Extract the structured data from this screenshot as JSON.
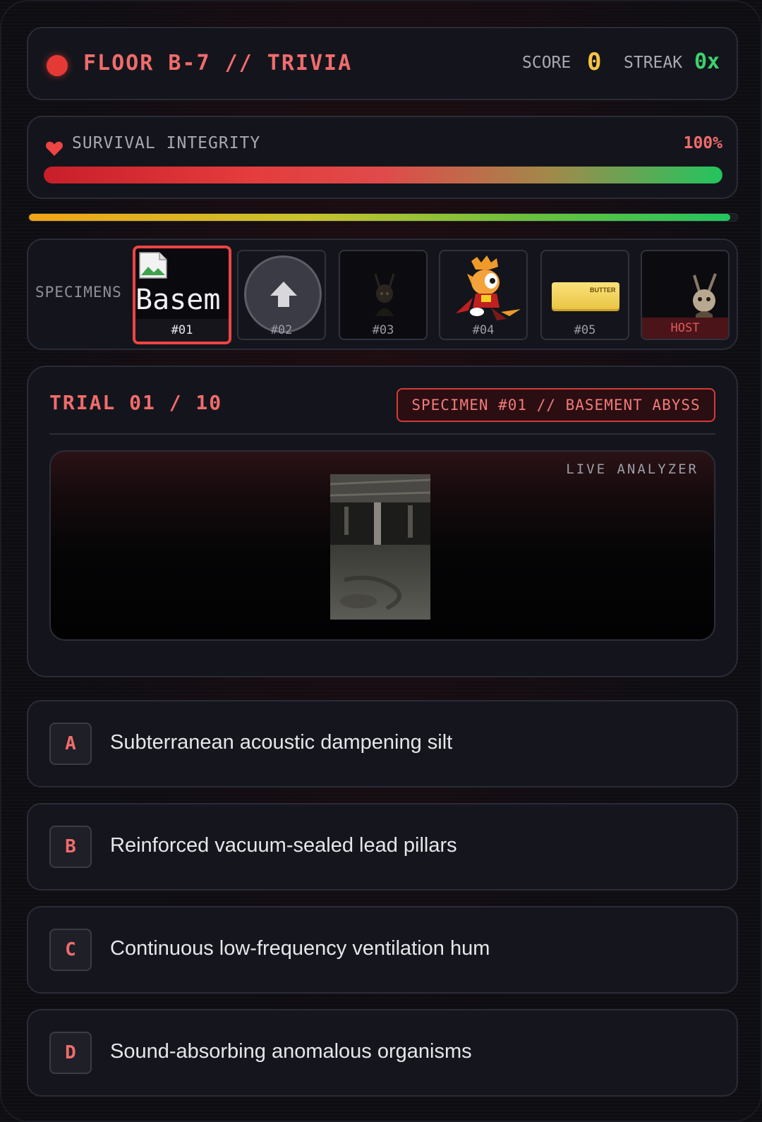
{
  "header": {
    "title": "FLOOR B-7 // TRIVIA",
    "score_label": "SCORE",
    "score_value": "0",
    "streak_label": "STREAK",
    "streak_value": "0x",
    "status_color": "#e53935"
  },
  "integrity": {
    "label": "SURVIVAL INTEGRITY",
    "percent_text": "100%",
    "level": 1.0,
    "icon": "heart-icon"
  },
  "timer": {
    "level": 0.99
  },
  "specimens": {
    "label": "SPECIMENS",
    "items": [
      {
        "id": "#01",
        "alt_text": "Basem",
        "active": true
      },
      {
        "id": "#02",
        "icon": "upload-icon"
      },
      {
        "id": "#03"
      },
      {
        "id": "#04"
      },
      {
        "id": "#05",
        "image_text": "BUTTER"
      },
      {
        "id": "HOST"
      }
    ]
  },
  "trial": {
    "title": "TRIAL 01 / 10",
    "specimen_tag": "SPECIMEN #01 // BASEMENT ABYSS",
    "analyzer_label": "LIVE ANALYZER"
  },
  "options": [
    {
      "letter": "A",
      "text": "Subterranean acoustic dampening silt"
    },
    {
      "letter": "B",
      "text": "Reinforced vacuum-sealed lead pillars"
    },
    {
      "letter": "C",
      "text": "Continuous low-frequency ventilation hum"
    },
    {
      "letter": "D",
      "text": "Sound-absorbing anomalous organisms"
    }
  ],
  "colors": {
    "accent_red": "#f06c6c",
    "score_yellow": "#f6c445",
    "streak_green": "#3ed16f"
  }
}
